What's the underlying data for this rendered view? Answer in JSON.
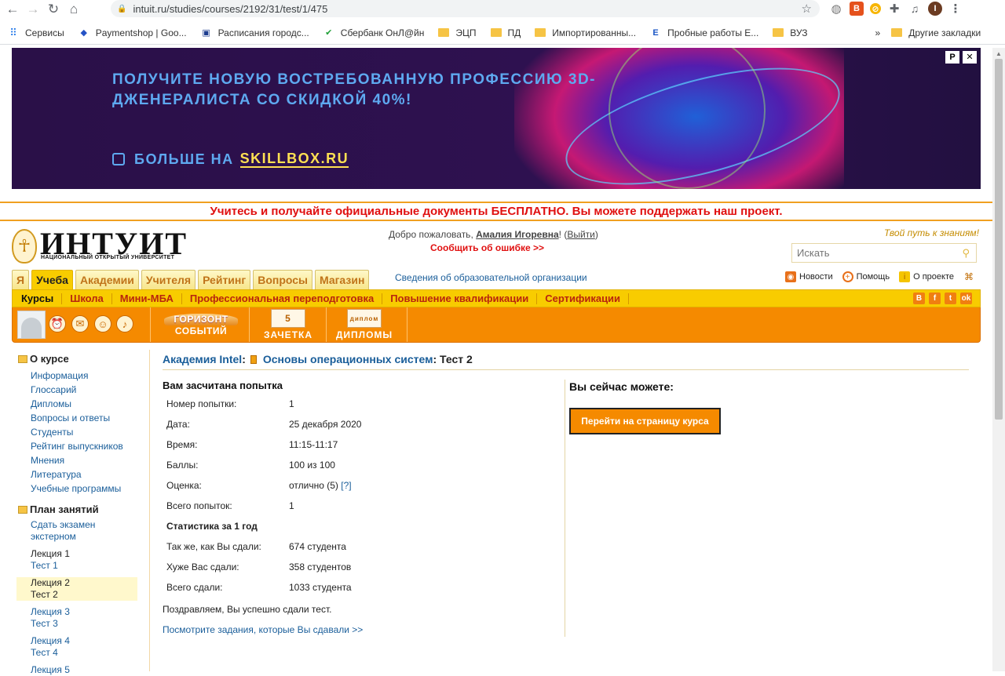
{
  "browser": {
    "url": "intuit.ru/studies/courses/2192/31/test/1/475",
    "bookmarks": [
      {
        "label": "Сервисы",
        "icon": "apps-icon"
      },
      {
        "label": "Paymentshop | Goo...",
        "icon": "paymentshop-icon"
      },
      {
        "label": "Расписания городс...",
        "icon": "bus-icon"
      },
      {
        "label": "Сбербанк ОнЛ@йн",
        "icon": "sberbank-icon"
      },
      {
        "label": "ЭЦП",
        "icon": "folder-icon"
      },
      {
        "label": "ПД",
        "icon": "folder-icon"
      },
      {
        "label": "Импортированны...",
        "icon": "folder-icon"
      },
      {
        "label": "Пробные работы Е...",
        "icon": "ege-icon"
      },
      {
        "label": "ВУЗ",
        "icon": "folder-icon"
      }
    ],
    "bookmarks_more": "»",
    "other_bookmarks": "Другие закладки",
    "profile_initial": "I"
  },
  "banner": {
    "headline": "ПОЛУЧИТЕ НОВУЮ ВОСТРЕБОВАННУЮ ПРОФЕССИЮ 3D-ДЖЕНЕРАЛИСТА СО СКИДКОЙ 40%!",
    "more_prefix": "БОЛЬШЕ НА",
    "site": "SKILLBOX.RU",
    "ad_label": "Р",
    "close": "✕"
  },
  "notice": "Учитесь и получайте официальные документы БЕСПЛАТНО. Вы можете поддержать наш проект.",
  "header": {
    "logo_word": "ИНТУИТ",
    "logo_sub": "НАЦИОНАЛЬНЫЙ ОТКРЫТЫЙ УНИВЕРСИТЕТ",
    "welcome_prefix": "Добро пожаловать,",
    "user_name": "Амалия Игоревна",
    "welcome_excl": "!",
    "logout_open": "(",
    "logout": "Выйти",
    "logout_close": ")",
    "report_error": "Сообщить об ошибке >>",
    "slogan": "Твой путь к знаниям!",
    "search_placeholder": "Искать"
  },
  "main_tabs": [
    "Я",
    "Учеба",
    "Академии",
    "Учителя",
    "Рейтинг",
    "Вопросы",
    "Магазин"
  ],
  "org_info": "Сведения об образовательной организации",
  "top_links": {
    "news": "Новости",
    "help": "Помощь",
    "about": "О проекте"
  },
  "subnav": [
    "Курсы",
    "Школа",
    "Мини-МБА",
    "Профессиональная переподготовка",
    "Повышение квалификации",
    "Сертификации"
  ],
  "toolbar": {
    "horizon_1": "ГОРИЗОНТ",
    "horizon_2": "СОБЫТИЙ",
    "zachetka": "ЗАЧЕТКА",
    "zachetka_num": "5",
    "diplomas": "ДИПЛОМЫ",
    "diploma_pic": "диплом"
  },
  "sidebar": {
    "about_title": "О курсе",
    "about_links": [
      "Информация",
      "Глоссарий",
      "Дипломы",
      "Вопросы и ответы",
      "Студенты",
      "Рейтинг выпускников",
      "Мнения",
      "Литература",
      "Учебные программы"
    ],
    "plan_title": "План занятий",
    "external_exam": [
      "Сдать экзамен",
      "экстерном"
    ],
    "lectures": [
      {
        "lecture": "Лекция 1",
        "test": "Тест 1"
      },
      {
        "lecture": "Лекция 2",
        "test": "Тест 2"
      },
      {
        "lecture": "Лекция 3",
        "test": "Тест 3"
      },
      {
        "lecture": "Лекция 4",
        "test": "Тест 4"
      },
      {
        "lecture": "Лекция 5",
        "test": ""
      }
    ]
  },
  "breadcrumb": {
    "academy": "Академия Intel",
    "sep": ":",
    "course": "Основы операционных систем",
    "sep2": ":",
    "test": "Тест 2"
  },
  "result": {
    "title": "Вам засчитана попытка",
    "rows": [
      {
        "k": "Номер попытки:",
        "v": "1"
      },
      {
        "k": "Дата:",
        "v": "25 декабря 2020"
      },
      {
        "k": "Время:",
        "v": "11:15-11:17"
      },
      {
        "k": "Баллы:",
        "v": "100 из 100"
      },
      {
        "k": "Оценка:",
        "v": "отлично (5)",
        "help": "[?]"
      },
      {
        "k": "Всего попыток:",
        "v": "1"
      }
    ],
    "stats_title": "Статистика за 1 год",
    "stats": [
      {
        "k": "Так же, как Вы сдали:",
        "v": "674 студента"
      },
      {
        "k": "Хуже Вас сдали:",
        "v": "358 студентов"
      },
      {
        "k": "Всего сдали:",
        "v": "1033 студента"
      }
    ],
    "congrats": "Поздравляем, Вы успешно сдали тест.",
    "review_link": "Посмотрите задания, которые Вы сдавали >>"
  },
  "actions": {
    "title": "Вы сейчас можете:",
    "goto_course": "Перейти на страницу курса"
  }
}
